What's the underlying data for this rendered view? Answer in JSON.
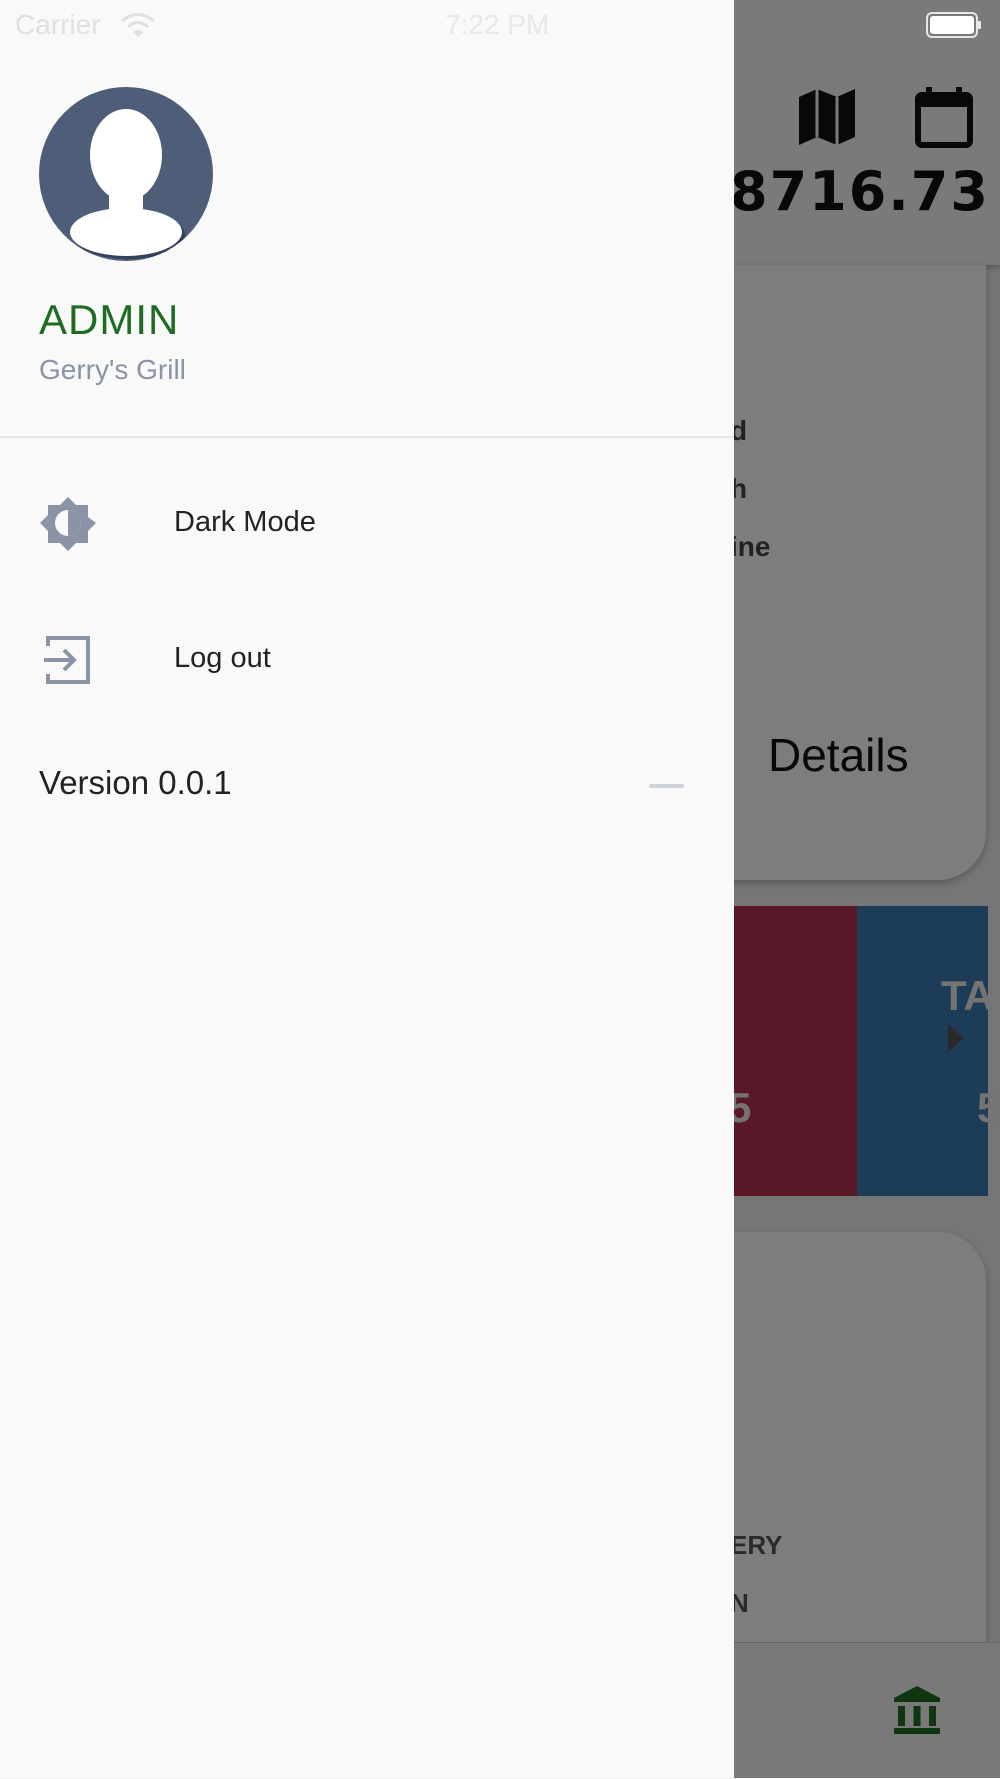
{
  "status_bar": {
    "carrier": "Carrier",
    "time": "7:22 PM"
  },
  "background": {
    "header_icons": [
      "map-icon",
      "calendar-icon"
    ],
    "amount": "8716.73",
    "card_lines": [
      "d",
      "h",
      "ine"
    ],
    "card_button": "Details",
    "tiles": {
      "red_value": "5",
      "blue_heading": "TA",
      "blue_value": "5",
      "red_color": "#b03050",
      "blue_color": "#3a78b0"
    },
    "card2_lines": [
      "ERY",
      "N"
    ],
    "bottom_nav_icon": "bank-icon"
  },
  "drawer": {
    "profile": {
      "avatar_icon": "avatar-icon",
      "name": "ADMIN",
      "organization": "Gerry's Grill"
    },
    "menu": [
      {
        "label": "Dark Mode",
        "icon": "brightness-icon"
      },
      {
        "label": "Log out",
        "icon": "logout-icon"
      }
    ],
    "version": "Version 0.0.1"
  },
  "colors": {
    "accent_green": "#1e6b22",
    "avatar_bg": "#4e5e78",
    "muted_icon": "#8a94a6"
  }
}
